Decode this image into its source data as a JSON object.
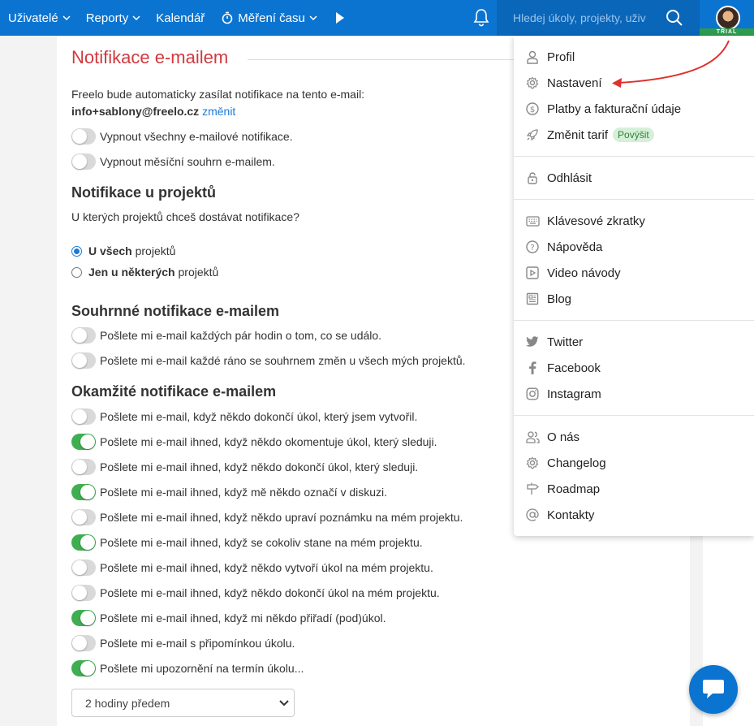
{
  "nav": {
    "users": "Uživatelé",
    "reports": "Reporty",
    "calendar": "Kalendář",
    "time": "Měření času"
  },
  "search": {
    "placeholder": "Hledej úkoly, projekty, uživ"
  },
  "account": {
    "trial_label": "TRIAL"
  },
  "page": {
    "title": "Notifikace e-mailem",
    "intro": "Freelo bude automaticky zasílat notifikace na tento e-mail:",
    "email": "info+sablony@freelo.cz",
    "change_link": "změnit",
    "email_toggles": [
      {
        "label": "Vypnout všechny e-mailové notifikace.",
        "on": false
      },
      {
        "label": "Vypnout měsíční souhrn e-mailem.",
        "on": false
      }
    ],
    "projects": {
      "heading": "Notifikace u projektů",
      "question": "U kterých projektů chceš dostávat notifikace?",
      "options": [
        {
          "bold": "U všech",
          "rest": " projektů",
          "selected": true
        },
        {
          "bold": "Jen u některých",
          "rest": " projektů",
          "selected": false
        }
      ]
    },
    "summary": {
      "heading": "Souhrnné notifikace e-mailem",
      "toggles": [
        {
          "label": "Pošlete mi e-mail každých pár hodin o tom, co se událo.",
          "on": false
        },
        {
          "label": "Pošlete mi e-mail každé ráno se souhrnem změn u všech mých projektů.",
          "on": false
        }
      ]
    },
    "instant": {
      "heading": "Okamžité notifikace e-mailem",
      "toggles": [
        {
          "label": "Pošlete mi e-mail, když někdo dokončí úkol, který jsem vytvořil.",
          "on": false
        },
        {
          "label": "Pošlete mi e-mail ihned, když někdo okomentuje úkol, který sleduji.",
          "on": true
        },
        {
          "label": "Pošlete mi e-mail ihned, když někdo dokončí úkol, který sleduji.",
          "on": false
        },
        {
          "label": "Pošlete mi e-mail ihned, když mě někdo označí v diskuzi.",
          "on": true
        },
        {
          "label": "Pošlete mi e-mail ihned, když někdo upraví poznámku na mém projektu.",
          "on": false
        },
        {
          "label": "Pošlete mi e-mail ihned, když se cokoliv stane na mém projektu.",
          "on": true
        },
        {
          "label": "Pošlete mi e-mail ihned, když někdo vytvoří úkol na mém projektu.",
          "on": false
        },
        {
          "label": "Pošlete mi e-mail ihned, když někdo dokončí úkol na mém projektu.",
          "on": false
        },
        {
          "label": "Pošlete mi e-mail ihned, když mi někdo přiřadí (pod)úkol.",
          "on": true
        },
        {
          "label": "Pošlete mi e-mail s připomínkou úkolu.",
          "on": false
        },
        {
          "label": "Pošlete mi upozornění na termín úkolu...",
          "on": true
        }
      ]
    },
    "reminder_select": "2 hodiny předem"
  },
  "menu": {
    "profile": "Profil",
    "settings": "Nastavení",
    "billing": "Platby a fakturační údaje",
    "plan": "Změnit tarif",
    "plan_badge": "Povýšit",
    "logout": "Odhlásit",
    "shortcuts": "Klávesové zkratky",
    "help": "Nápověda",
    "videos": "Video návody",
    "blog": "Blog",
    "twitter": "Twitter",
    "facebook": "Facebook",
    "instagram": "Instagram",
    "about": "O nás",
    "changelog": "Changelog",
    "roadmap": "Roadmap",
    "contacts": "Kontakty"
  },
  "colors": {
    "primary": "#0b74d1",
    "title_red": "#d0393d",
    "toggle_on": "#3fae51",
    "arrow_red": "#e0302c"
  }
}
